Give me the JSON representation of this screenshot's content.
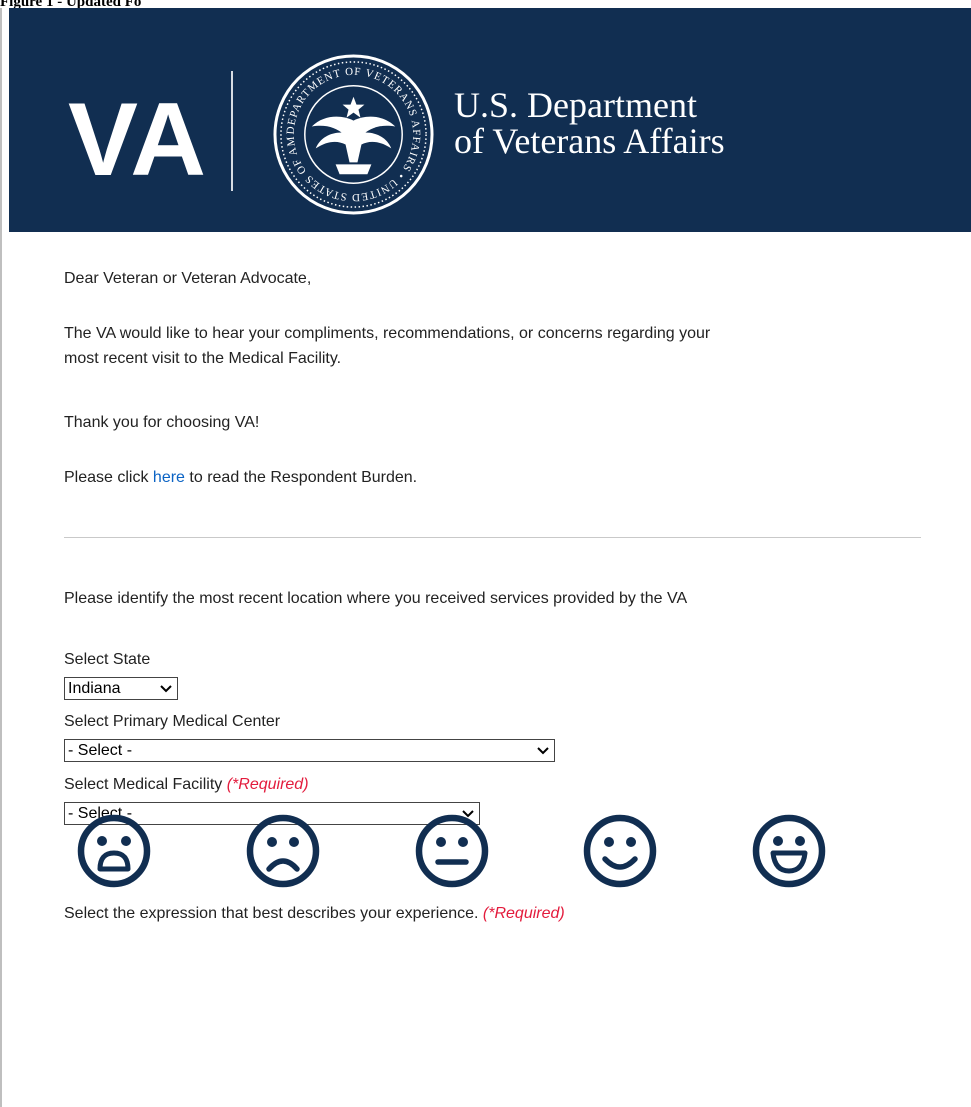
{
  "caption": "Figure 1 - Updated Fo",
  "header": {
    "logo_text": "VA",
    "seal_text": "DEPARTMENT OF VETERANS AFFAIRS • UNITED STATES OF AMERICA",
    "department_line1": "U.S. Department",
    "department_line2": "of Veterans Affairs",
    "colors": {
      "banner": "#112e51",
      "text": "#ffffff"
    }
  },
  "intro": {
    "greeting": "Dear Veteran or Veteran Advocate,",
    "message_line1": "The VA would like to hear your compliments, recommendations, or concerns regarding your",
    "message_line2": "most recent visit to the Medical Facility.",
    "thanks": "Thank you for choosing VA!",
    "burden_prefix": "Please click ",
    "burden_link": "here",
    "burden_suffix": " to read the Respondent Burden."
  },
  "location": {
    "prompt": "Please identify the most recent location where you received services provided by the VA",
    "state_label": "Select State",
    "state_value": "Indiana",
    "primary_label": "Select Primary Medical Center",
    "primary_value": "- Select -",
    "facility_label": "Select Medical Facility ",
    "facility_required": "(*Required)",
    "facility_value": "- Select -"
  },
  "experience": {
    "prompt": "Select the expression that best describes your experience. ",
    "required": "(*Required)",
    "faces": [
      {
        "icon": "very-unhappy-face-icon"
      },
      {
        "icon": "unhappy-face-icon"
      },
      {
        "icon": "neutral-face-icon"
      },
      {
        "icon": "happy-face-icon"
      },
      {
        "icon": "very-happy-face-icon"
      }
    ],
    "face_color": "#112e51"
  }
}
